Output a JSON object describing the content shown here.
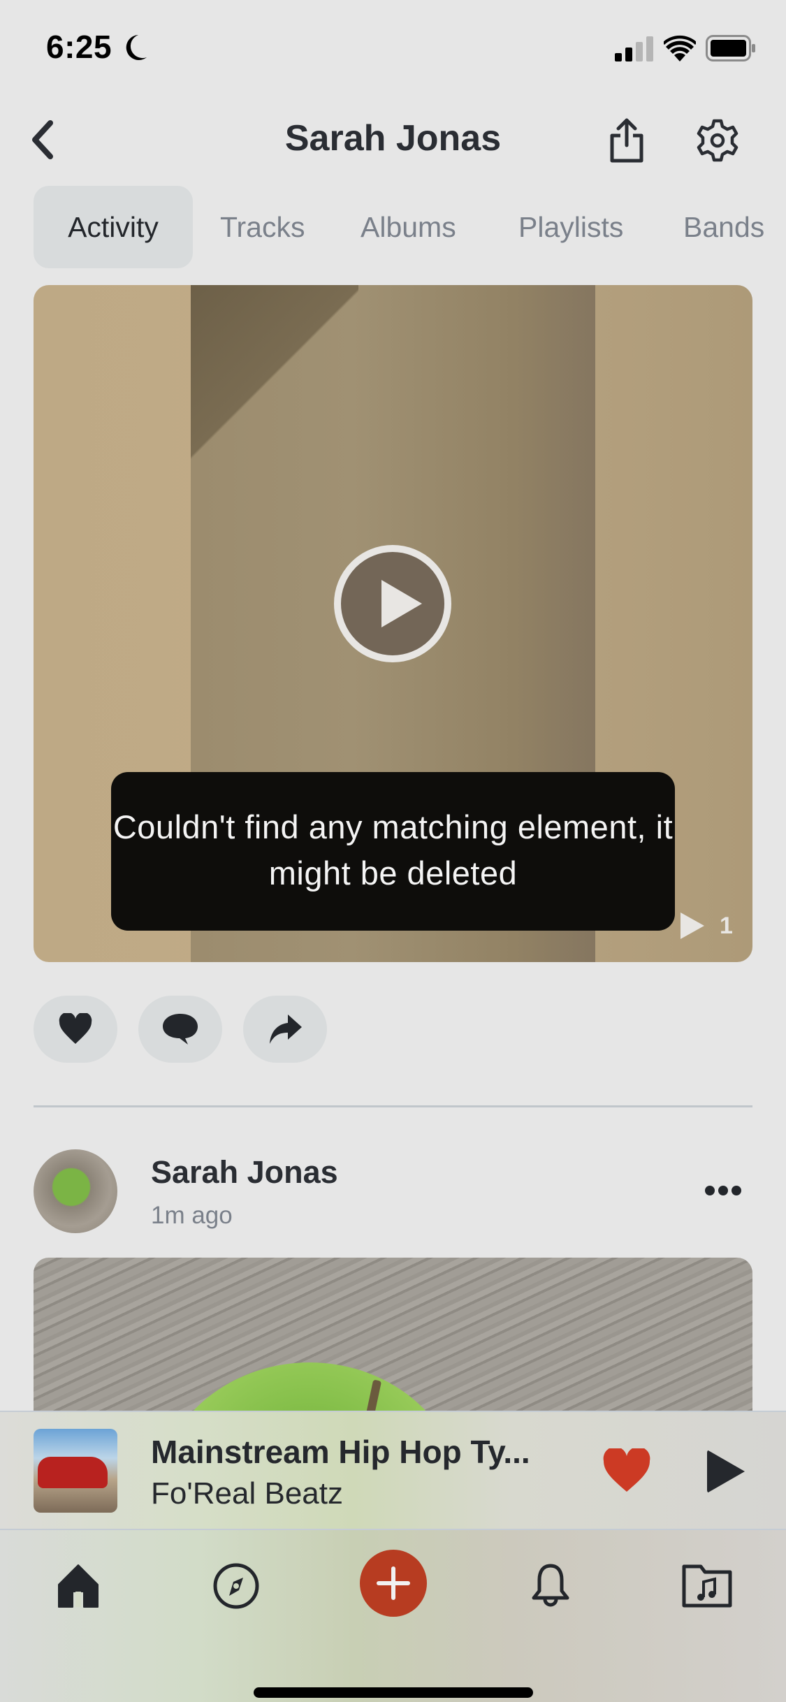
{
  "status_bar": {
    "time": "6:25",
    "icons": [
      "moon-icon",
      "cellular-signal-icon",
      "wifi-icon",
      "battery-icon"
    ]
  },
  "header": {
    "title": "Sarah Jonas",
    "back_icon": "chevron-left-icon",
    "share_icon": "share-icon",
    "settings_icon": "gear-icon"
  },
  "tabs": [
    {
      "label": "Activity",
      "active": true
    },
    {
      "label": "Tracks",
      "active": false
    },
    {
      "label": "Albums",
      "active": false
    },
    {
      "label": "Playlists",
      "active": false
    },
    {
      "label": "Bands",
      "active": false
    }
  ],
  "video_post": {
    "play_icon": "play-icon",
    "view_count": "1",
    "toast": "Couldn't find any matching element, it might be deleted"
  },
  "actions": [
    {
      "name": "like",
      "icon": "heart-icon"
    },
    {
      "name": "comment",
      "icon": "speech-bubble-icon"
    },
    {
      "name": "share",
      "icon": "share-arrow-icon"
    }
  ],
  "post": {
    "author": "Sarah Jonas",
    "time": "1m ago",
    "more_icon": "ellipsis-icon"
  },
  "mini_player": {
    "track": "Mainstream Hip Hop Ty...",
    "artist": "Fo'Real Beatz",
    "liked": true,
    "like_color": "#cc3a24"
  },
  "nav": {
    "items": [
      "home",
      "explore",
      "add",
      "notifications",
      "library"
    ],
    "accent_color": "#b73c21"
  }
}
